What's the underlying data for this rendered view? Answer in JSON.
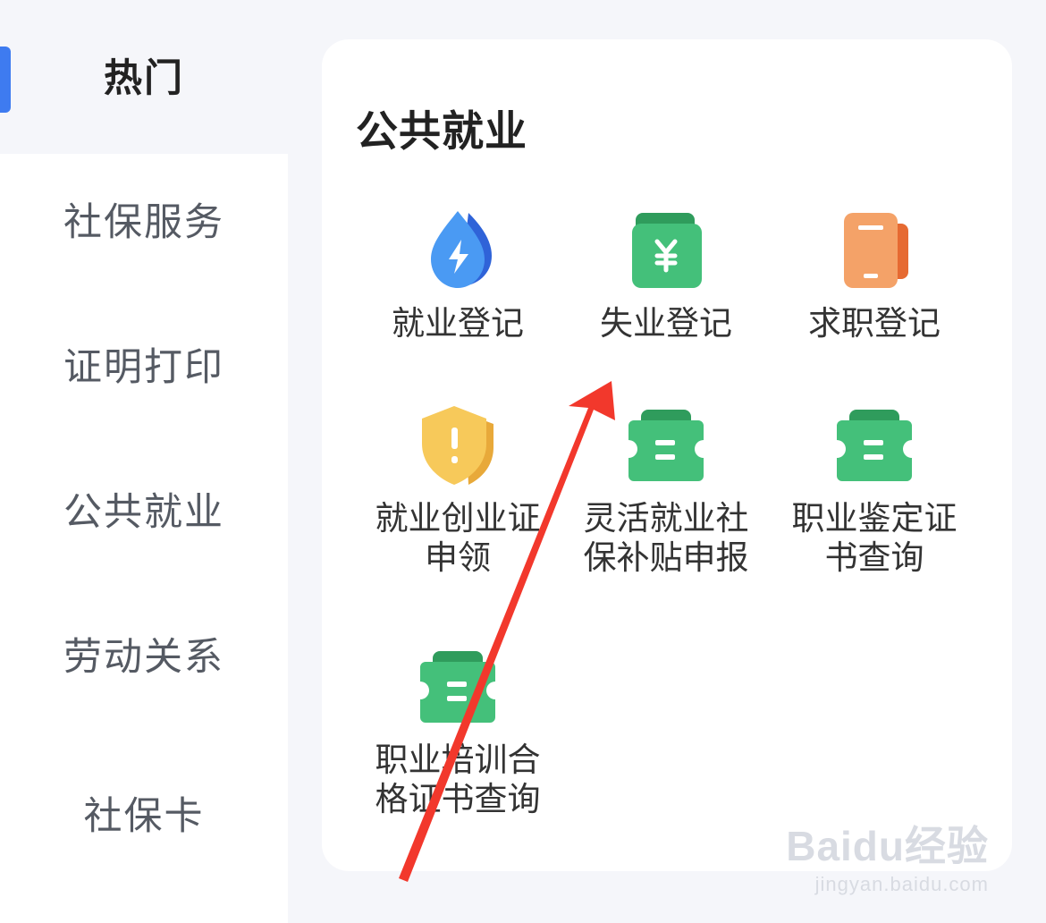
{
  "sidebar": {
    "items": [
      {
        "label": "热门",
        "active": true
      },
      {
        "label": "社保服务",
        "active": false
      },
      {
        "label": "证明打印",
        "active": false
      },
      {
        "label": "公共就业",
        "active": false
      },
      {
        "label": "劳动关系",
        "active": false
      },
      {
        "label": "社保卡",
        "active": false
      }
    ],
    "accent_color": "#3e7bf0"
  },
  "card": {
    "title": "公共就业",
    "services": [
      {
        "label": "就业登记",
        "icon": "drop-lightning-icon",
        "color": "#3d8ff0"
      },
      {
        "label": "失业登记",
        "icon": "wallet-yen-icon",
        "color": "#3fbf73"
      },
      {
        "label": "求职登记",
        "icon": "phone-icon",
        "color": "#f28c45"
      },
      {
        "label": "就业创业证申领",
        "icon": "shield-alert-icon",
        "color": "#f5c04a"
      },
      {
        "label": "灵活就业社保补贴申报",
        "icon": "ticket-icon",
        "color": "#3fbf73"
      },
      {
        "label": "职业鉴定证书查询",
        "icon": "ticket-icon",
        "color": "#3fbf73"
      },
      {
        "label": "职业培训合格证书查询",
        "icon": "ticket-icon",
        "color": "#3fbf73"
      }
    ]
  },
  "annotation": {
    "arrow_color": "#f2382c"
  },
  "watermark": {
    "brand": "Baidu经验",
    "url": "jingyan.baidu.com"
  }
}
